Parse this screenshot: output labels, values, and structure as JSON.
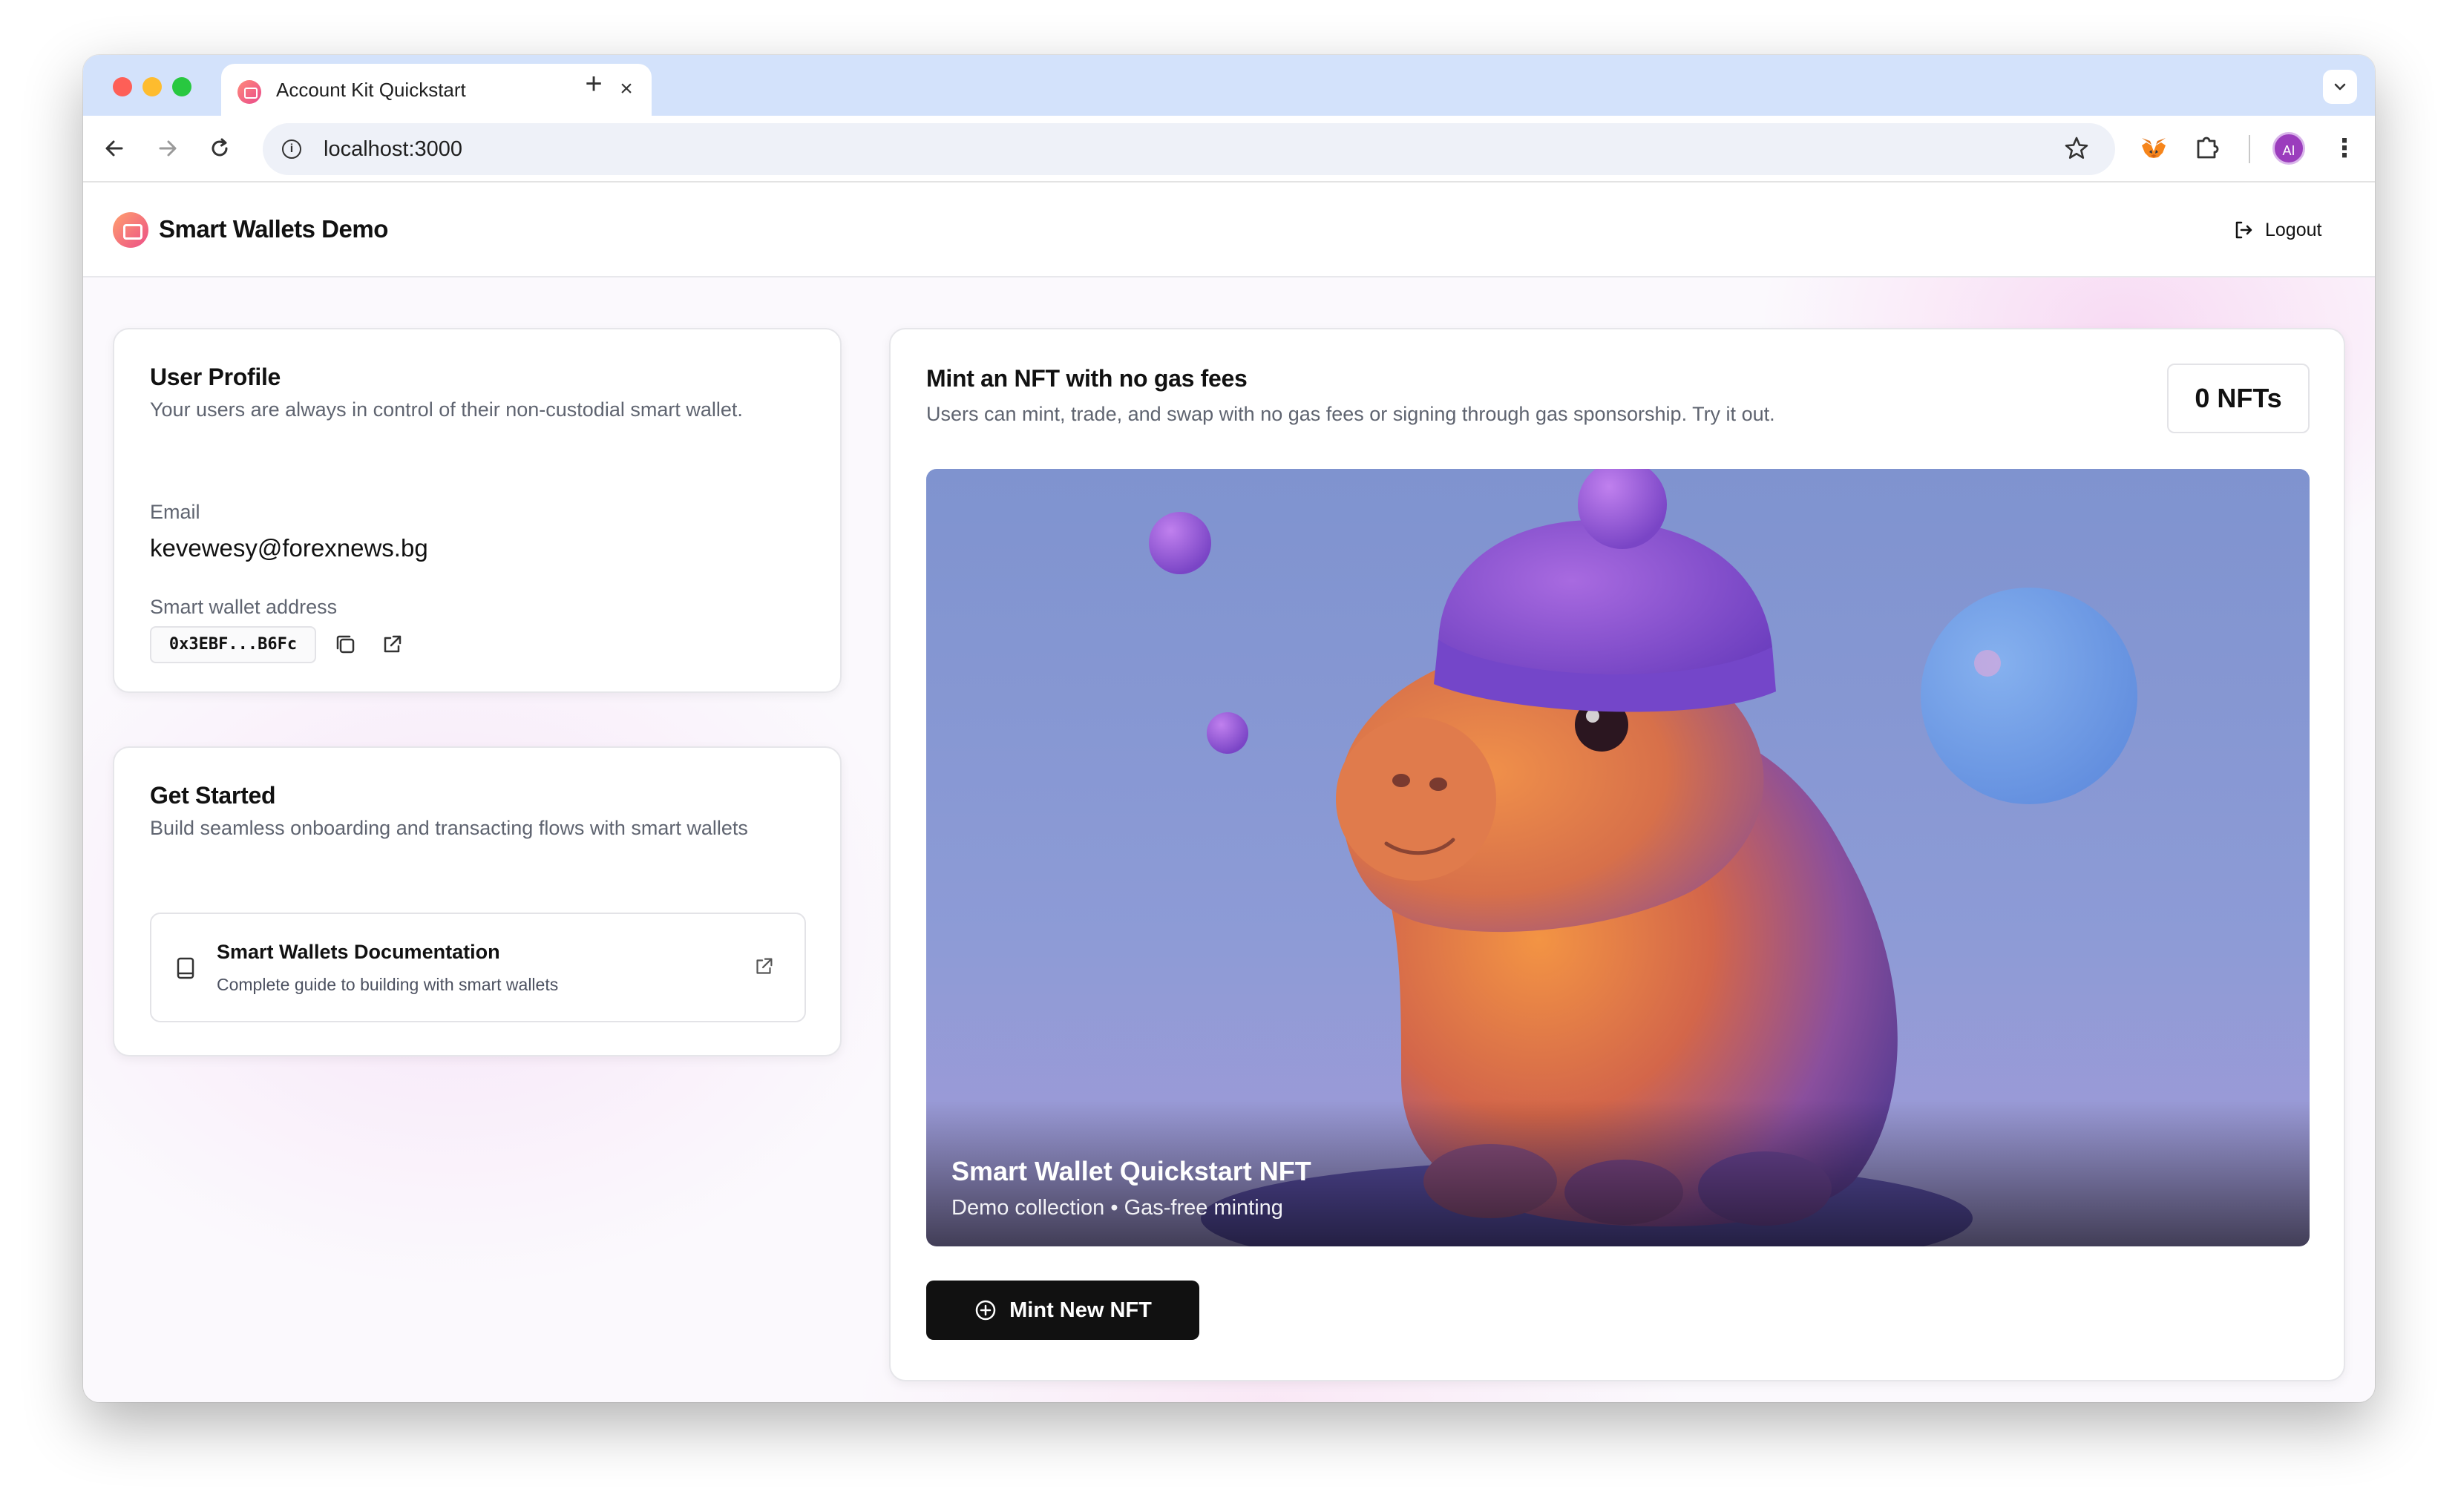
{
  "browser": {
    "tab_title": "Account Kit Quickstart",
    "url": "localhost:3000",
    "avatar_initials": "AI"
  },
  "app": {
    "brand": "Smart Wallets Demo",
    "logout_label": "Logout"
  },
  "profile": {
    "title": "User Profile",
    "description": "Your users are always in control of their non-custodial smart wallet.",
    "email_label": "Email",
    "email_value": "kevewesy@forexnews.bg",
    "wallet_label": "Smart wallet address",
    "wallet_address": "0x3EBF...B6Fc"
  },
  "get_started": {
    "title": "Get Started",
    "description": "Build seamless onboarding and transacting flows with smart wallets",
    "doc_title": "Smart Wallets Documentation",
    "doc_subtitle": "Complete guide to building with smart wallets"
  },
  "mint": {
    "title": "Mint an NFT with no gas fees",
    "description": "Users can mint, trade, and swap with no gas fees or signing through gas sponsorship. Try it out.",
    "nft_count": "0 NFTs",
    "nft_name": "Smart Wallet Quickstart NFT",
    "nft_meta": "Demo collection • Gas-free minting",
    "button_label": "Mint New NFT"
  },
  "colors": {
    "accent_gradient_start": "#ffa06e",
    "accent_gradient_end": "#ec4f87",
    "button_bg": "#111111",
    "art_background": "#8d9bd0"
  }
}
